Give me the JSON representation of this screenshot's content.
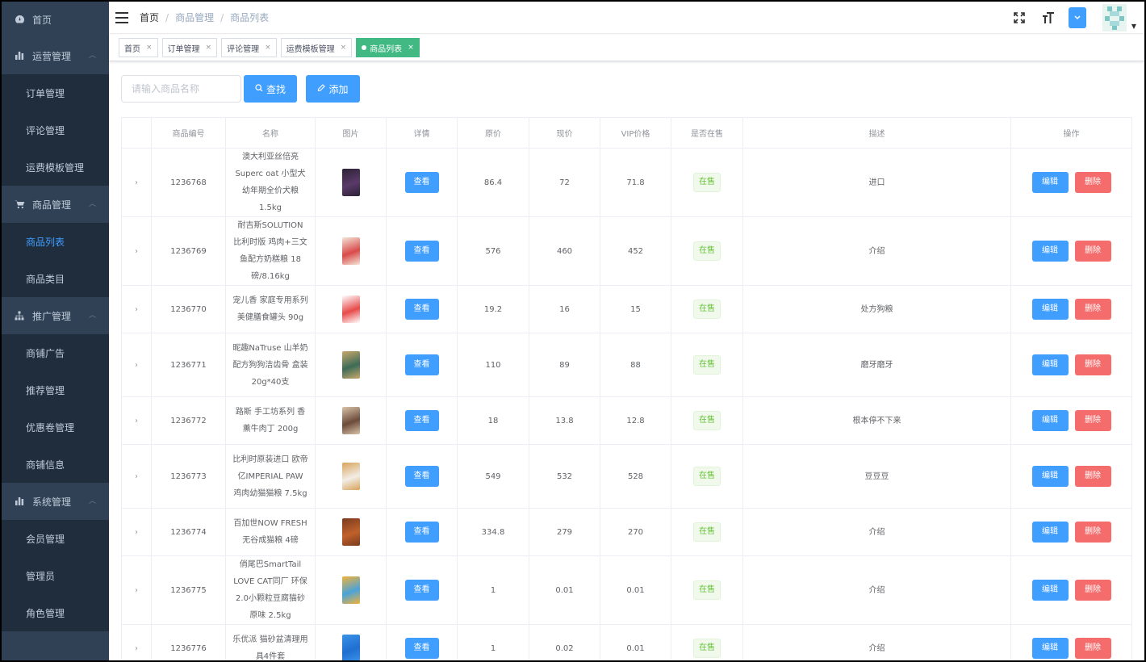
{
  "sidebar": {
    "home": "首页",
    "groups": [
      {
        "label": "运营管理",
        "icon": "bar-chart-icon",
        "items": [
          "订单管理",
          "评论管理",
          "运费模板管理"
        ]
      },
      {
        "label": "商品管理",
        "icon": "cart-icon",
        "items": [
          "商品列表",
          "商品类目"
        ]
      },
      {
        "label": "推广管理",
        "icon": "sitemap-icon",
        "items": [
          "商铺广告",
          "推荐管理",
          "优惠卷管理",
          "商铺信息"
        ]
      },
      {
        "label": "系统管理",
        "icon": "bar-chart-icon",
        "items": [
          "会员管理",
          "管理员",
          "角色管理"
        ]
      }
    ],
    "active_item": "商品列表"
  },
  "header": {
    "breadcrumb": [
      "首页",
      "商品管理",
      "商品列表"
    ]
  },
  "tags": [
    {
      "label": "首页",
      "active": false
    },
    {
      "label": "订单管理",
      "active": false
    },
    {
      "label": "评论管理",
      "active": false
    },
    {
      "label": "运费模板管理",
      "active": false
    },
    {
      "label": "商品列表",
      "active": true
    }
  ],
  "toolbar": {
    "search_placeholder": "请输入商品名称",
    "search_label": "查找",
    "add_label": "添加"
  },
  "table": {
    "columns": [
      "",
      "商品编号",
      "名称",
      "图片",
      "详情",
      "原价",
      "现价",
      "VIP价格",
      "是否在售",
      "描述",
      "操作"
    ],
    "view_label": "查看",
    "edit_label": "编辑",
    "delete_label": "删除",
    "rows": [
      {
        "id": "1236768",
        "name": "澳大利亚丝倍亮Superc oat 小型犬幼年期全价犬粮 1.5kg",
        "orig": "86.4",
        "price": "72",
        "vip": "71.8",
        "status": "在售",
        "desc": "进口",
        "thumb_colors": [
          "#5a3a6a",
          "#2d2235"
        ]
      },
      {
        "id": "1236769",
        "name": "耐吉斯SOLUTION 比利时版 鸡肉+三文鱼配方奶糕粮 18磅/8.16kg",
        "orig": "576",
        "price": "460",
        "vip": "452",
        "status": "在售",
        "desc": "介绍",
        "thumb_colors": [
          "#d94a4a",
          "#f3e6d8"
        ]
      },
      {
        "id": "1236770",
        "name": "宠儿香 家庭专用系列 美健膳食罐头 90g",
        "orig": "19.2",
        "price": "16",
        "vip": "15",
        "status": "在售",
        "desc": "处方狗粮",
        "thumb_colors": [
          "#e84a4a",
          "#ffffff"
        ]
      },
      {
        "id": "1236771",
        "name": "昵趣NaTruse 山羊奶配方狗狗洁齿骨 盒装20g*40支",
        "orig": "110",
        "price": "89",
        "vip": "88",
        "status": "在售",
        "desc": "磨牙磨牙",
        "thumb_colors": [
          "#3d6b57",
          "#c8a86b"
        ]
      },
      {
        "id": "1236772",
        "name": "路斯 手工坊系列 香薰牛肉丁 200g",
        "orig": "18",
        "price": "13.8",
        "vip": "12.8",
        "status": "在售",
        "desc": "根本停不下来",
        "thumb_colors": [
          "#6b4b3a",
          "#d9c3a8"
        ]
      },
      {
        "id": "1236773",
        "name": "比利时原装进口 欧帝亿IMPERIAL PAW 鸡肉幼猫猫粮 7.5kg",
        "orig": "549",
        "price": "532",
        "vip": "528",
        "status": "在售",
        "desc": "豆豆豆",
        "thumb_colors": [
          "#f2ede6",
          "#d8a35a"
        ]
      },
      {
        "id": "1236774",
        "name": "百加世NOW FRESH 无谷成猫粮 4磅",
        "orig": "334.8",
        "price": "279",
        "vip": "270",
        "status": "在售",
        "desc": "介绍",
        "thumb_colors": [
          "#c0612b",
          "#7a3b1f"
        ]
      },
      {
        "id": "1236775",
        "name": "俏尾巴SmartTail LOVE CAT同厂 环保2.0小颗粒豆腐猫砂 原味 2.5kg",
        "orig": "1",
        "price": "0.01",
        "vip": "0.01",
        "status": "在售",
        "desc": "介绍",
        "thumb_colors": [
          "#4aa3d9",
          "#f2b23a"
        ]
      },
      {
        "id": "1236776",
        "name": "乐优派 猫砂盆清理用具4件套",
        "orig": "1",
        "price": "0.02",
        "vip": "0.01",
        "status": "在售",
        "desc": "介绍",
        "thumb_colors": [
          "#1f6fd1",
          "#3a93e6"
        ]
      }
    ]
  }
}
